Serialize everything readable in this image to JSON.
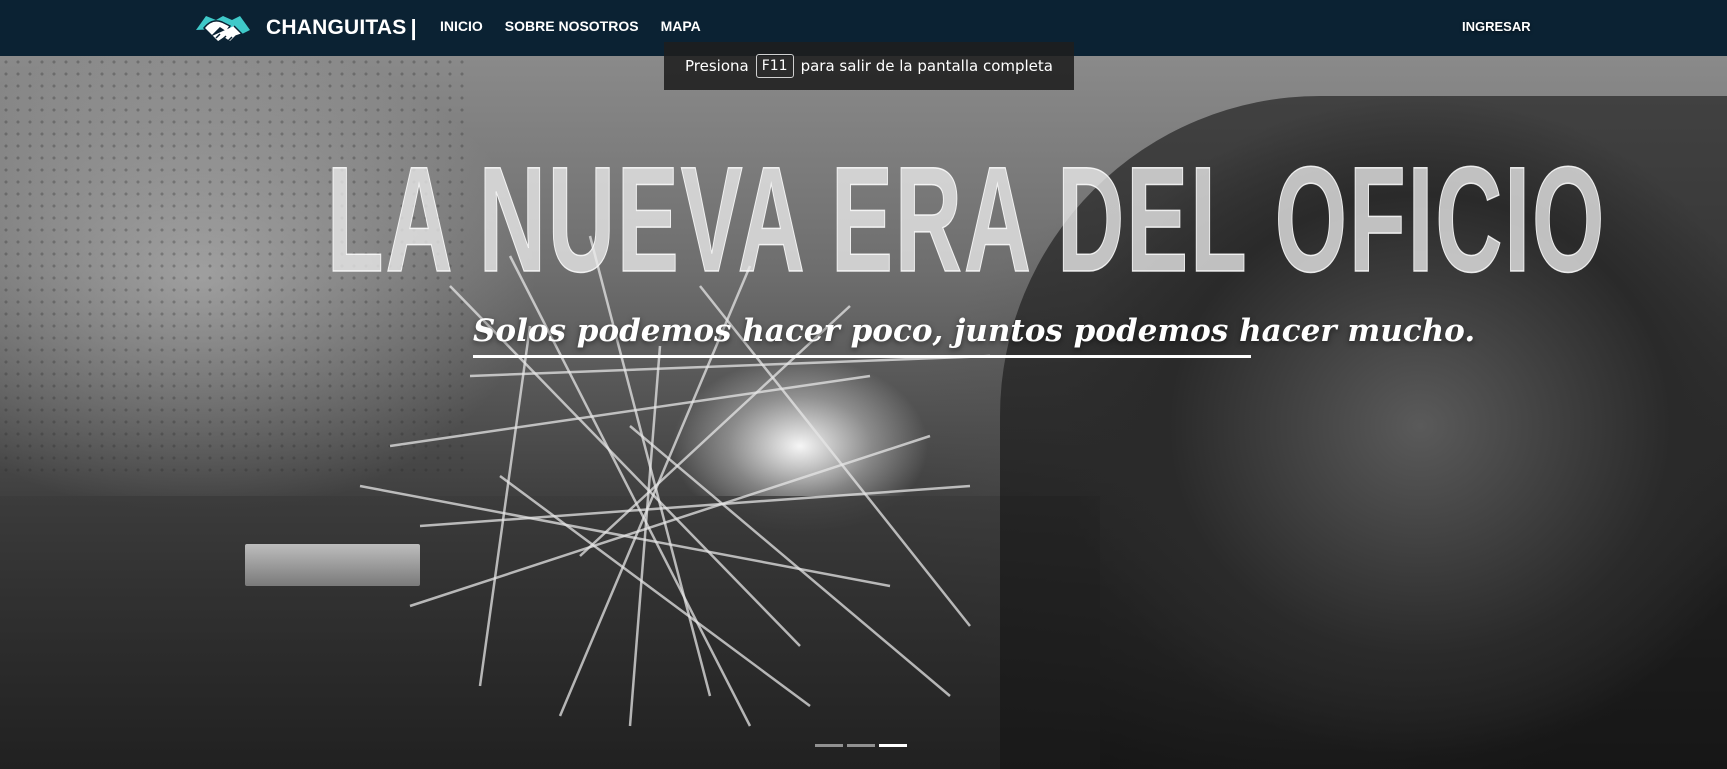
{
  "navbar": {
    "brand": "CHANGUITAS",
    "separator": "|",
    "links": [
      "INICIO",
      "SOBRE NOSOTROS",
      "MAPA"
    ],
    "login": "INGRESAR",
    "background": "#0b2233"
  },
  "fullscreen_toast": {
    "prefix": "Presiona",
    "key": "F11",
    "suffix": "para salir de la pantalla completa"
  },
  "hero": {
    "title": "LA NUEVA ERA DEL OFICIO",
    "subtitle": "Solos podemos hacer poco, juntos podemos hacer mucho.",
    "slides_count": 3,
    "active_slide": 3
  },
  "icons": {
    "logo": "handshake-icon"
  }
}
